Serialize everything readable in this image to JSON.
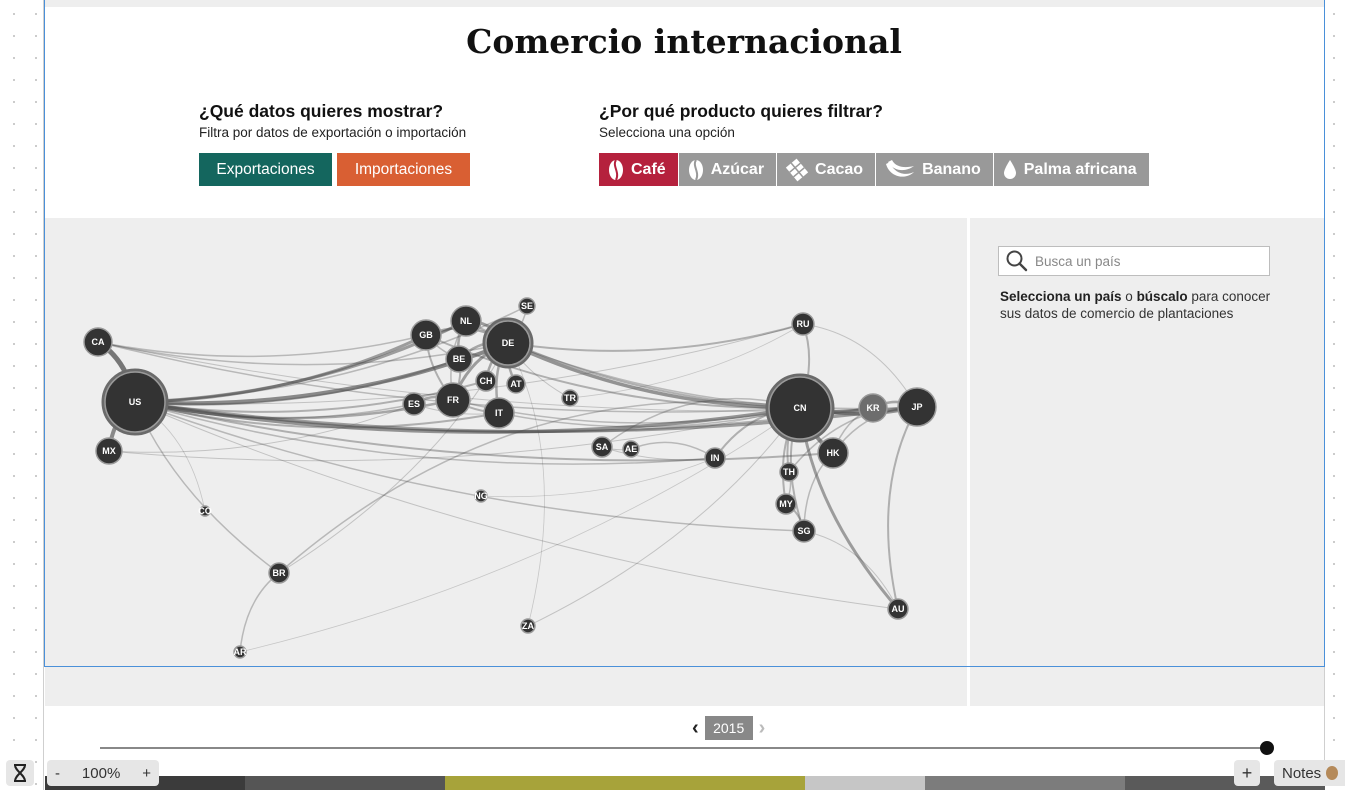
{
  "title": "Comercio internacional",
  "data_control": {
    "heading": "¿Qué datos quieres mostrar?",
    "subheading": "Filtra por datos de exportación o importación",
    "export_label": "Exportaciones",
    "import_label": "Importaciones",
    "export_color": "#14665e",
    "import_color": "#d95f33"
  },
  "product_control": {
    "heading": "¿Por qué producto quieres filtrar?",
    "subheading": "Selecciona una opción",
    "active_color": "#b5213d",
    "inactive_color": "#999999",
    "products": [
      {
        "label": "Café",
        "icon": "coffee-bean-icon",
        "active": true
      },
      {
        "label": "Azúcar",
        "icon": "sugar-icon",
        "active": false
      },
      {
        "label": "Cacao",
        "icon": "chocolate-icon",
        "active": false
      },
      {
        "label": "Banano",
        "icon": "banana-icon",
        "active": false
      },
      {
        "label": "Palma africana",
        "icon": "drop-icon",
        "active": false
      }
    ]
  },
  "network": {
    "countries": [
      "CA",
      "US",
      "MX",
      "GB",
      "NL",
      "SE",
      "DE",
      "BE",
      "CH",
      "AT",
      "FR",
      "ES",
      "IT",
      "TR",
      "RU",
      "CN",
      "KR",
      "JP",
      "HK",
      "SA",
      "AE",
      "IN",
      "TH",
      "MY",
      "SG",
      "NG",
      "CO",
      "BR",
      "ZA",
      "AR",
      "AU"
    ]
  },
  "sidebar": {
    "search_placeholder": "Busca un país",
    "info_bold_1": "Selecciona un país",
    "info_text_1": " o ",
    "info_bold_2": "búscalo",
    "info_text_2": " para conocer sus datos de comercio de plantaciones"
  },
  "timeline": {
    "year": "2015",
    "position": 1.0
  },
  "toolbar": {
    "zoom_out": "-",
    "zoom_level": "100%",
    "zoom_in": "+",
    "add": "+",
    "notes_label": "Notes"
  }
}
